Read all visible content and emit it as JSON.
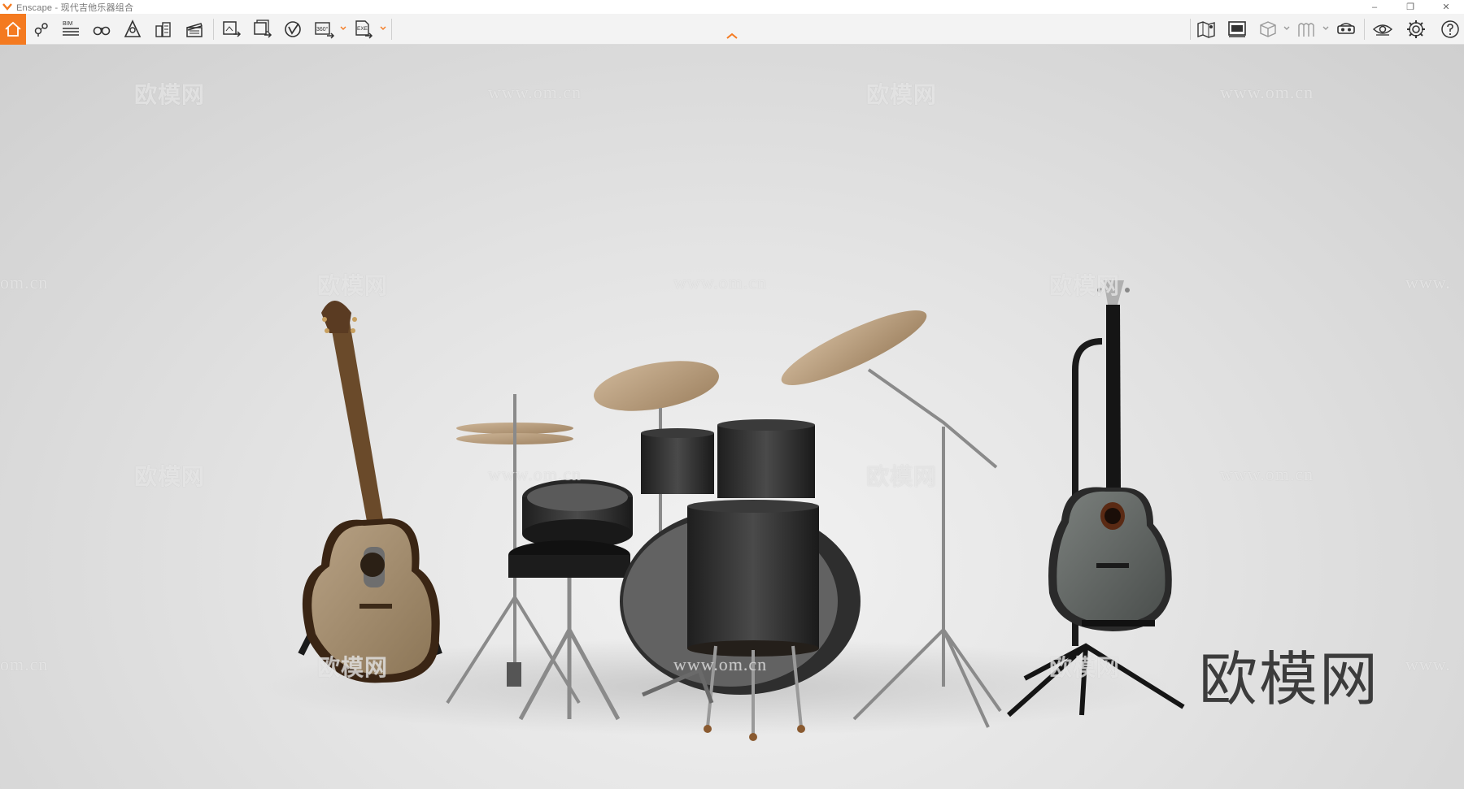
{
  "window": {
    "title": "Enscape - 现代吉他乐器组合"
  },
  "toolbar": {
    "left_buttons": [
      "home-button",
      "position-button",
      "bim-button",
      "views-button",
      "sky-button",
      "assets-button",
      "video-editor-button",
      "screenshot-button",
      "batch-render-button",
      "export-vr-button",
      "panorama-360-button",
      "export-exe-button"
    ],
    "bim_label": "BIM",
    "pano_label": "360°",
    "exe_label": "EXE"
  },
  "watermarks": {
    "logo_text": "欧模网",
    "url_text": "www.om.cn",
    "url_fragment_left": "om.cn",
    "url_fragment_right": "www."
  },
  "colors": {
    "accent": "#f47a20",
    "viewport_bg": "#dcdcdc"
  }
}
